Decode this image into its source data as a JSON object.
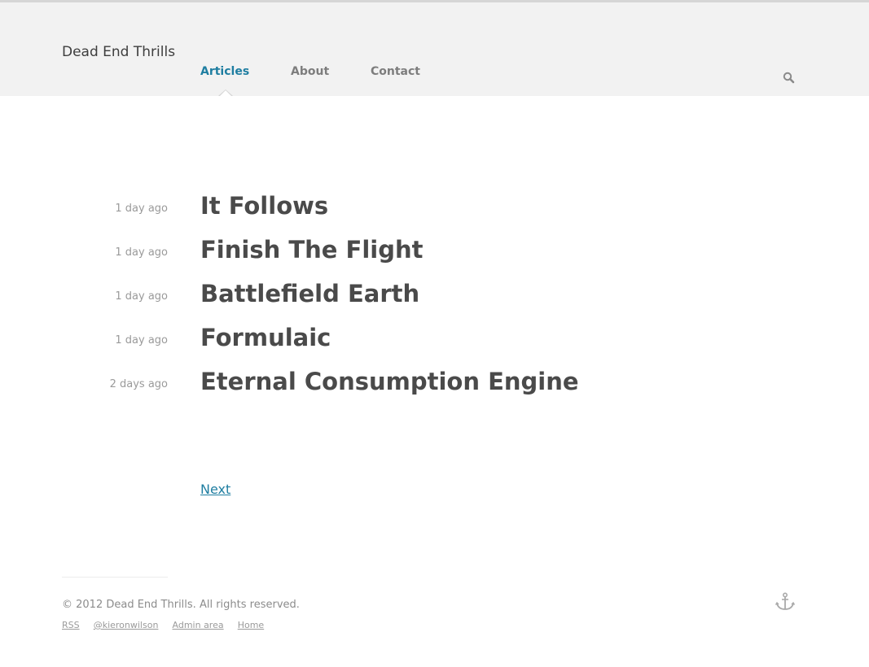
{
  "site": {
    "title": "Dead End Thrills"
  },
  "nav": {
    "items": [
      "Articles",
      "About",
      "Contact"
    ],
    "active": "Articles"
  },
  "search": {
    "icon": "search-icon"
  },
  "articles": [
    {
      "date": "1 day ago",
      "title": "It Follows"
    },
    {
      "date": "1 day ago",
      "title": "Finish The Flight"
    },
    {
      "date": "1 day ago",
      "title": "Battlefield Earth"
    },
    {
      "date": "1 day ago",
      "title": "Formulaic"
    },
    {
      "date": "2 days ago",
      "title": "Eternal Consumption Engine"
    }
  ],
  "pagination": {
    "next_label": "Next"
  },
  "footer": {
    "copyright": "© 2012 Dead End Thrills. All rights reserved.",
    "links": [
      "RSS",
      "@kieronwilson",
      "Admin area",
      "Home"
    ],
    "icon": "anchor-icon"
  },
  "colors": {
    "accent": "#1f7ea1",
    "header_bg": "#f2f2f2",
    "text": "#4a4a4a",
    "muted": "#9a9a9a"
  }
}
